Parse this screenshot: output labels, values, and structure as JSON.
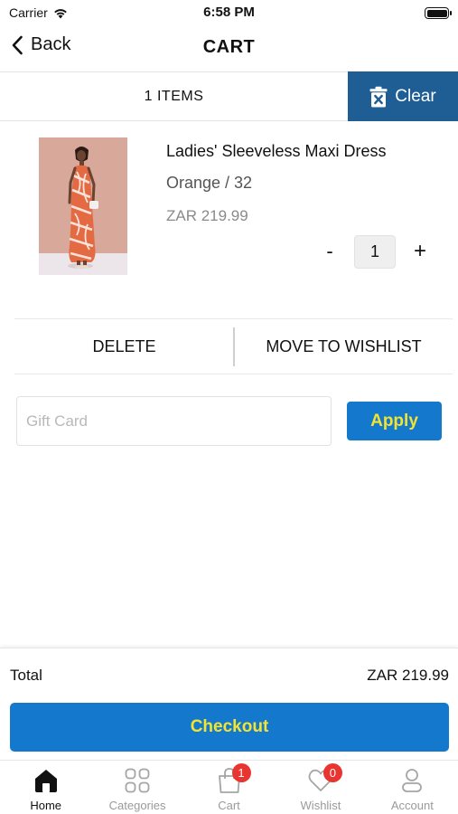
{
  "status_bar": {
    "carrier": "Carrier",
    "time": "6:58 PM"
  },
  "nav": {
    "back_label": "Back",
    "title": "CART"
  },
  "cart_header": {
    "items_count": "1 ITEMS",
    "clear_label": "Clear"
  },
  "item": {
    "name": "Ladies' Sleeveless Maxi Dress",
    "variant": "Orange / 32",
    "price": "ZAR 219.99",
    "quantity": "1",
    "decrement_label": "-",
    "increment_label": "+"
  },
  "actions": {
    "delete_label": "DELETE",
    "wishlist_label": "MOVE TO WISHLIST"
  },
  "gift_card": {
    "placeholder": "Gift Card",
    "value": "",
    "apply_label": "Apply"
  },
  "summary": {
    "total_label": "Total",
    "total_value": "ZAR 219.99",
    "checkout_label": "Checkout"
  },
  "tabs": [
    {
      "label": "Home",
      "icon": "home-icon",
      "active": true
    },
    {
      "label": "Categories",
      "icon": "grid-icon"
    },
    {
      "label": "Cart",
      "icon": "shopping-bag-icon",
      "badge": "1"
    },
    {
      "label": "Wishlist",
      "icon": "heart-icon",
      "badge": "0"
    },
    {
      "label": "Account",
      "icon": "user-icon"
    }
  ],
  "colors": {
    "primary_blue": "#1478cc",
    "clear_button_blue": "#1f5d95",
    "button_text_yellow": "#f3e332",
    "badge_red": "#e8352f"
  }
}
